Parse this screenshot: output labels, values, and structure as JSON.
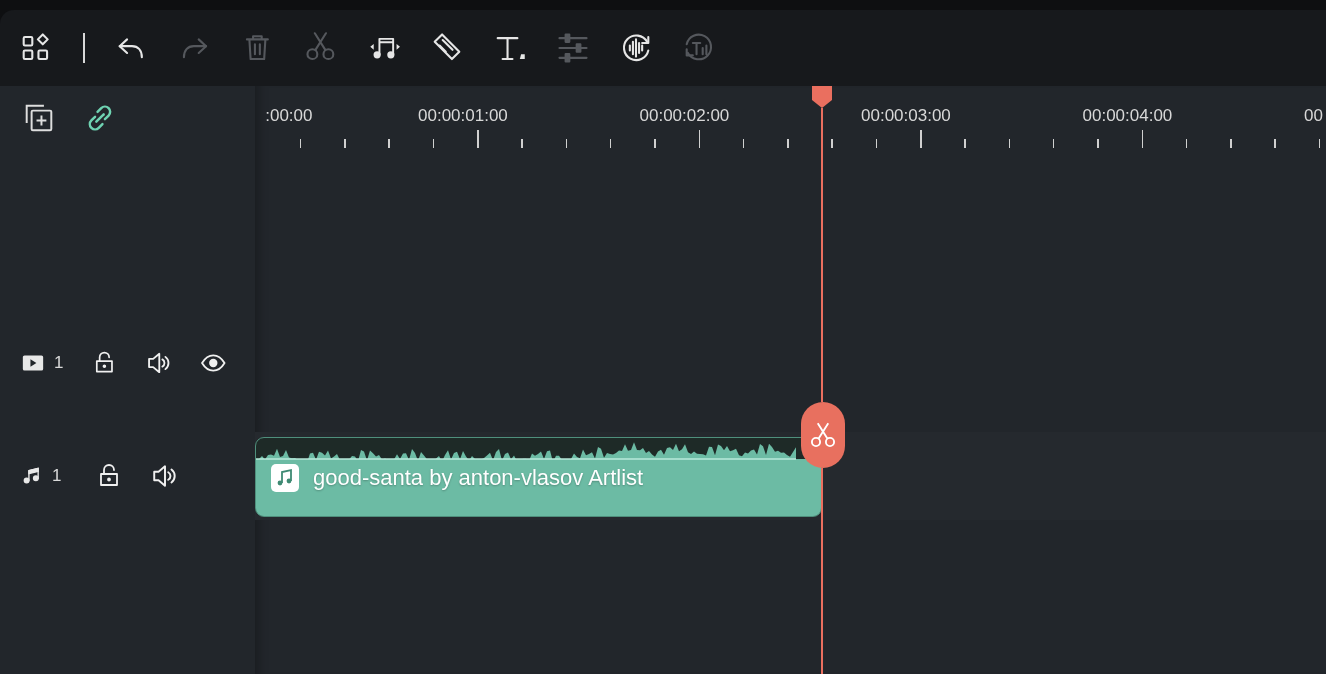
{
  "toolbar": {
    "items": [
      {
        "kind": "layout",
        "disabled": false
      },
      {
        "kind": "separator"
      },
      {
        "kind": "undo",
        "disabled": false
      },
      {
        "kind": "redo",
        "disabled": true
      },
      {
        "kind": "delete",
        "disabled": true
      },
      {
        "kind": "cut",
        "disabled": true
      },
      {
        "kind": "audio",
        "disabled": false
      },
      {
        "kind": "crop",
        "disabled": false
      },
      {
        "kind": "text",
        "disabled": false
      },
      {
        "kind": "adjust",
        "disabled": true
      },
      {
        "kind": "voice",
        "disabled": false
      },
      {
        "kind": "speech",
        "disabled": true
      }
    ]
  },
  "timeline_header": {
    "link": {
      "on": true
    }
  },
  "ruler": {
    "labels": [
      ":00:00",
      "00:00:01:00",
      "00:00:02:00",
      "00:00:03:00",
      "00:00:04:00",
      "00"
    ]
  },
  "tracks": [
    {
      "kind": "video",
      "number": "1",
      "locked": false,
      "muted": false,
      "visible": true
    },
    {
      "kind": "audio",
      "number": "1",
      "locked": false,
      "muted": false,
      "clip": {
        "title": "good-santa by anton-vlasov Artlist"
      }
    }
  ]
}
